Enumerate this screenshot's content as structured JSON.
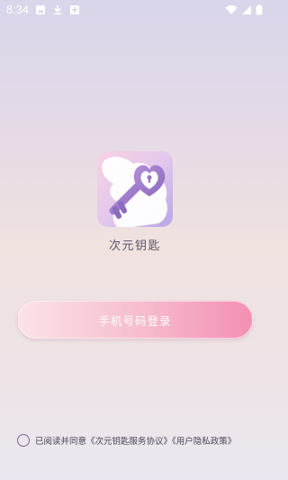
{
  "status_bar": {
    "time": "8:34",
    "icons": [
      "image-icon",
      "download-icon",
      "app-notification-icon",
      "wifi-icon",
      "signal-icon",
      "battery-icon"
    ]
  },
  "app": {
    "name": "次元钥匙",
    "logo_icon": "key-heart-logo-icon"
  },
  "login": {
    "button_label": "手机号码登录"
  },
  "agreement": {
    "prefix": "已阅读并同意",
    "service_link": "《次元钥匙服务协议》",
    "privacy_link": "《用户隐私政策》",
    "checked": false
  },
  "colors": {
    "accent_pink": "#f48fb4",
    "key_purple": "#9b78c4"
  }
}
